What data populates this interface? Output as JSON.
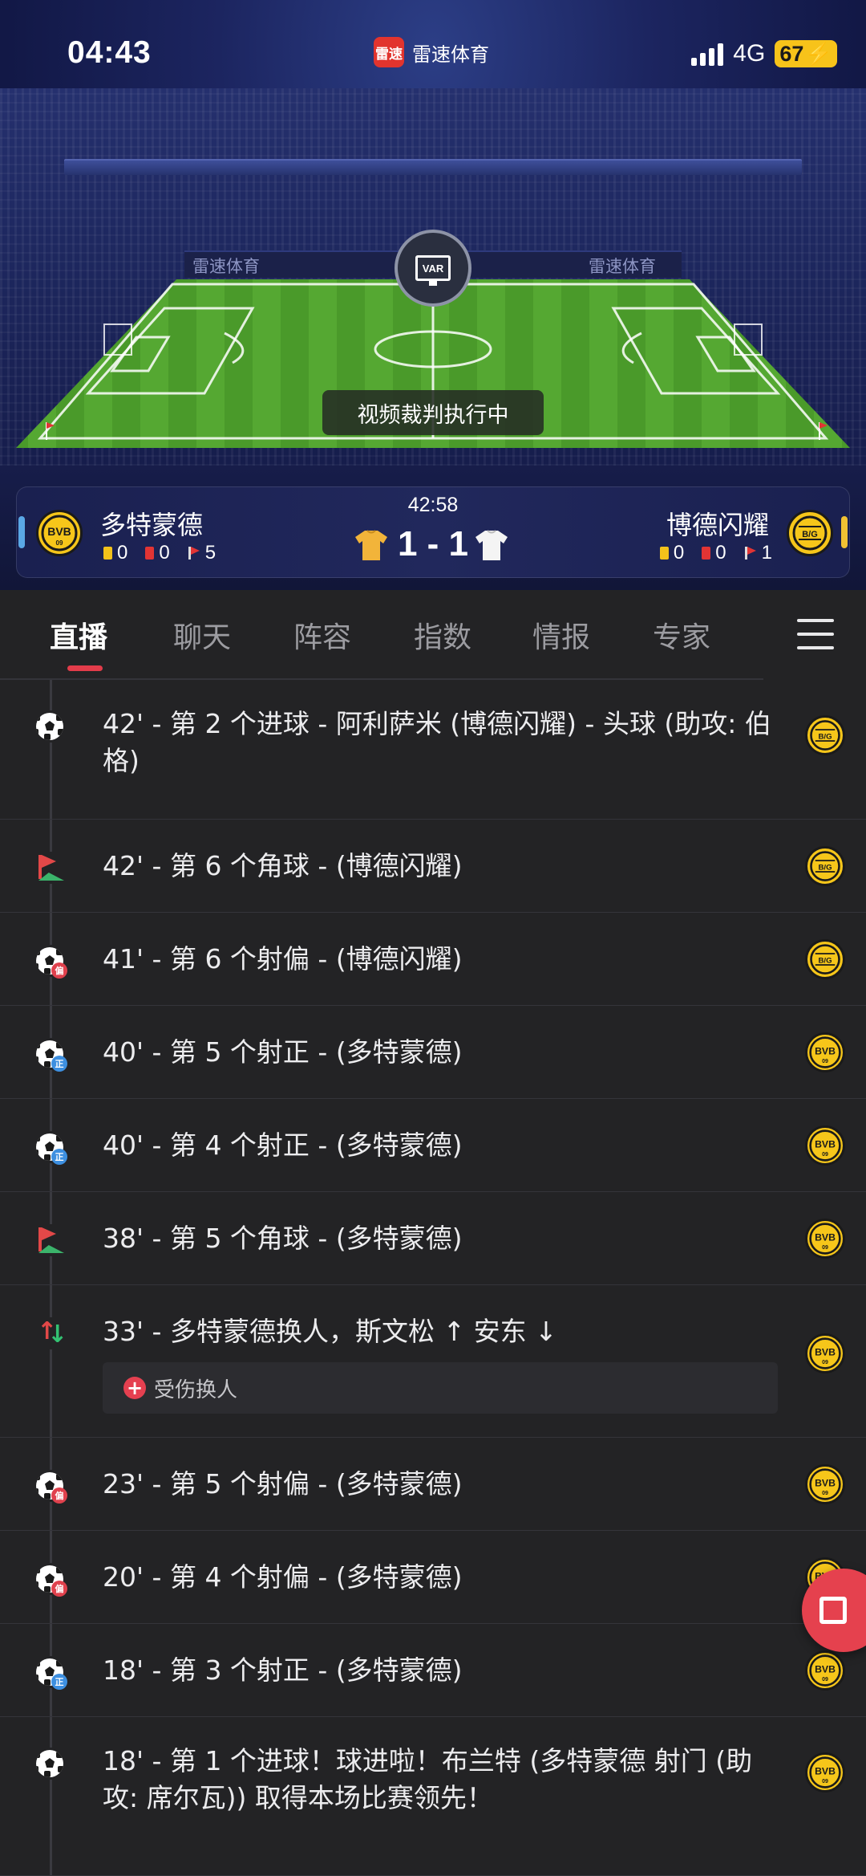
{
  "status_bar": {
    "time": "04:43",
    "app_badge": "雷速",
    "app_name": "雷速体育",
    "network": "4G",
    "battery": "67"
  },
  "hero": {
    "ad_text_left": "雷速体育",
    "ad_text_right": "雷速体育",
    "var_label": "VAR",
    "var_status": "视频裁判执行中"
  },
  "match": {
    "clock": "42:58",
    "score": "1 - 1",
    "home": {
      "name": "多特蒙德",
      "logo_text": "BVB",
      "yellow": "0",
      "red": "0",
      "corners": "5",
      "color": "#f6c61a"
    },
    "away": {
      "name": "博德闪耀",
      "logo_text": "B/G",
      "yellow": "0",
      "red": "0",
      "corners": "1",
      "color": "#f6c61a"
    }
  },
  "tabs": [
    {
      "label": "直播",
      "active": true
    },
    {
      "label": "聊天"
    },
    {
      "label": "阵容"
    },
    {
      "label": "指数"
    },
    {
      "label": "情报"
    },
    {
      "label": "专家"
    }
  ],
  "events": [
    {
      "icon": "goal-icon",
      "text": "42' - 第 2 个进球 - 阿利萨米 (博德闪耀) - 头球 (助攻: 伯格)",
      "team": "away"
    },
    {
      "icon": "corner-icon",
      "text": "42' - 第 6 个角球 - (博德闪耀)",
      "team": "away"
    },
    {
      "icon": "shot-off-icon",
      "text": "41' - 第 6 个射偏 - (博德闪耀)",
      "team": "away"
    },
    {
      "icon": "shot-on-icon",
      "text": "40' - 第 5 个射正 - (多特蒙德)",
      "team": "home"
    },
    {
      "icon": "shot-on-icon",
      "text": "40' - 第 4 个射正 - (多特蒙德)",
      "team": "home"
    },
    {
      "icon": "corner-icon",
      "text": "38' - 第 5 个角球 - (多特蒙德)",
      "team": "home"
    },
    {
      "icon": "substitution-icon",
      "text": "33' - 多特蒙德换人，斯文松 ↑ 安东 ↓",
      "team": "home",
      "note": "受伤换人"
    },
    {
      "icon": "shot-off-icon",
      "text": "23' - 第 5 个射偏 - (多特蒙德)",
      "team": "home"
    },
    {
      "icon": "shot-off-icon",
      "text": "20' - 第 4 个射偏 - (多特蒙德)",
      "team": "home"
    },
    {
      "icon": "shot-on-icon",
      "text": "18' - 第 3 个射正 - (多特蒙德)",
      "team": "home"
    },
    {
      "icon": "goal-icon",
      "text": "18' - 第 1 个进球！球进啦！布兰特 (多特蒙德 射门 (助攻: 席尔瓦)) 取得本场比赛领先！",
      "team": "home"
    }
  ],
  "badges": {
    "shot_off": "偏",
    "shot_on": "正"
  }
}
